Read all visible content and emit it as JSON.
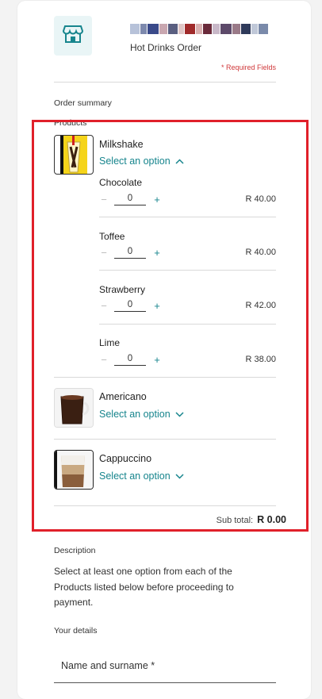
{
  "header": {
    "store_icon": "storefront-icon",
    "store_name_blurred": true,
    "subtitle": "Hot Drinks Order",
    "required_note": "* Required Fields"
  },
  "order_summary": {
    "title": "Order summary",
    "products_label": "Products",
    "products": [
      {
        "name": "Milkshake",
        "select_label": "Select an option",
        "expanded": true,
        "variants": [
          {
            "name": "Chocolate",
            "qty": "0",
            "price": "R 40.00"
          },
          {
            "name": "Toffee",
            "qty": "0",
            "price": "R 40.00"
          },
          {
            "name": "Strawberry",
            "qty": "0",
            "price": "R 42.00"
          },
          {
            "name": "Lime",
            "qty": "0",
            "price": "R 38.00"
          }
        ]
      },
      {
        "name": "Americano",
        "select_label": "Select an option",
        "expanded": false
      },
      {
        "name": "Cappuccino",
        "select_label": "Select an option",
        "expanded": false
      }
    ],
    "subtotal_label": "Sub total:",
    "subtotal_value": "R 0.00"
  },
  "description": {
    "title": "Description",
    "text": "Select at least one option from each of the Products listed below before proceeding to payment."
  },
  "your_details": {
    "title": "Your details",
    "name_label": "Name and surname *"
  },
  "colors": {
    "accent": "#17858d",
    "required": "#d0393b",
    "highlight_box": "#e0202a"
  },
  "stepper": {
    "minus_symbol": "−",
    "plus_symbol": "+"
  }
}
